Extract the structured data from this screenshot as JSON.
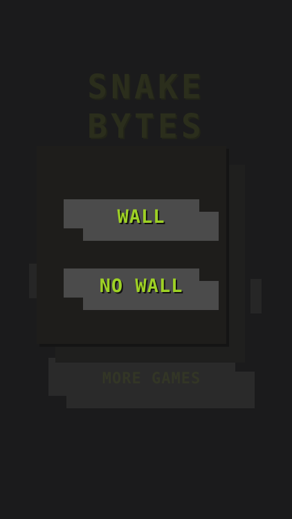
{
  "title": {
    "line1": "SNAKE",
    "line2": "BYTES"
  },
  "menu": {
    "wall_label": "WALL",
    "nowall_label": "NO WALL"
  },
  "more_games_label": "MORE GAMES",
  "colors": {
    "background": "#1b1b1c",
    "button": "#4b4b4b",
    "label": "#9ed125",
    "title": "#2b2e1c"
  }
}
